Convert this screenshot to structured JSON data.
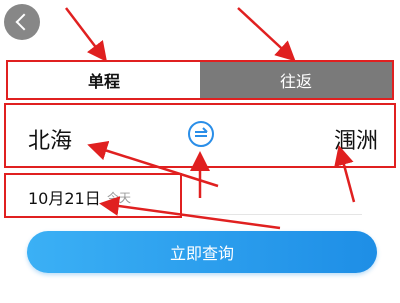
{
  "nav": {
    "back_icon": "back-icon"
  },
  "trip_type": {
    "tabs": [
      {
        "label": "单程",
        "selected": true
      },
      {
        "label": "往返",
        "selected": false
      }
    ]
  },
  "route": {
    "from": "北海",
    "to": "涠洲",
    "swap_icon": "swap-icon"
  },
  "date": {
    "value": "10月21日",
    "hint": "今天"
  },
  "search": {
    "label": "立即查询"
  },
  "colors": {
    "annotation_red": "#e02020",
    "accent_blue": "#1e8ee6",
    "tab_inactive_gray": "#7a7a7a"
  }
}
